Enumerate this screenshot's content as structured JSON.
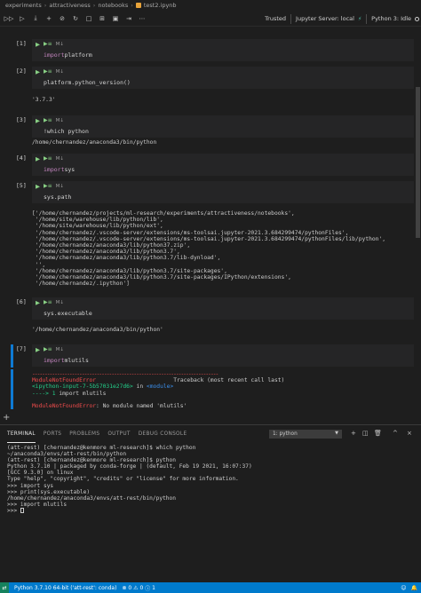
{
  "breadcrumb": {
    "items": [
      "experiments",
      "attractiveness",
      "notebooks",
      "test2.ipynb"
    ]
  },
  "toolbar": {
    "buttons": [
      {
        "icon": "run-all-icon",
        "glyph": "▷▷"
      },
      {
        "icon": "run-icon",
        "glyph": "▷"
      },
      {
        "icon": "run-below-icon",
        "glyph": "⤓"
      },
      {
        "icon": "add-icon",
        "glyph": "+"
      },
      {
        "icon": "clear-icon",
        "glyph": "⊘"
      },
      {
        "icon": "restart-icon",
        "glyph": "↻"
      },
      {
        "icon": "stop-icon",
        "glyph": "□"
      },
      {
        "icon": "variables-icon",
        "glyph": "⊞"
      },
      {
        "icon": "save-icon",
        "glyph": "▣"
      },
      {
        "icon": "export-icon",
        "glyph": "⇥"
      },
      {
        "icon": "more-icon",
        "glyph": "⋯"
      }
    ],
    "trusted": "Trusted",
    "jupyter_server": "Jupyter Server: local",
    "kernel": "Python 3: Idle"
  },
  "cells": [
    {
      "count": "[1]",
      "code_kw": "import",
      "code_rest": " platform",
      "output": ""
    },
    {
      "count": "[2]",
      "code_kw": "",
      "code_rest": "platform.python_version()",
      "output": "'3.7.3'"
    },
    {
      "count": "[3]",
      "code_kw": "",
      "code_rest": "!which python",
      "output": "/home/chernandez/anaconda3/bin/python"
    },
    {
      "count": "[4]",
      "code_kw": "import",
      "code_rest": " sys",
      "output": ""
    },
    {
      "count": "[5]",
      "code_kw": "",
      "code_rest": "sys.path",
      "output": "['/home/chernandez/projects/ml-research/experiments/attractiveness/notebooks',\n '/home/site/warehouse/lib/python/lib',\n '/home/site/warehouse/lib/python/ext',\n '/home/chernandez/.vscode-server/extensions/ms-toolsai.jupyter-2021.3.684299474/pythonFiles',\n '/home/chernandez/.vscode-server/extensions/ms-toolsai.jupyter-2021.3.684299474/pythonFiles/lib/python',\n '/home/chernandez/anaconda3/lib/python37.zip',\n '/home/chernandez/anaconda3/lib/python3.7',\n '/home/chernandez/anaconda3/lib/python3.7/lib-dynload',\n '',\n '/home/chernandez/anaconda3/lib/python3.7/site-packages',\n '/home/chernandez/anaconda3/lib/python3.7/site-packages/IPython/extensions',\n '/home/chernandez/.ipython']"
    },
    {
      "count": "[6]",
      "code_kw": "",
      "code_rest": "sys.executable",
      "output": "'/home/chernandez/anaconda3/bin/python'"
    },
    {
      "count": "[7]",
      "code_kw": "import",
      "code_rest": " mlutils",
      "output": ""
    }
  ],
  "error": {
    "dashes": "---------------------------------------------------------------------------",
    "name": "ModuleNotFoundError",
    "traceback_label": "Traceback (most recent call last)",
    "input_ref": "<ipython-input-7-5b57031e27d6>",
    "in_text": " in ",
    "module_ref": "<module>",
    "arrow": "----> 1 ",
    "arrow_code": "import mlutils",
    "message": ": No module named 'mlutils'"
  },
  "panel": {
    "tabs": [
      "TERMINAL",
      "PORTS",
      "PROBLEMS",
      "OUTPUT",
      "DEBUG CONSOLE"
    ],
    "terminal_select": "1: python",
    "terminal_lines": "(att-rest) [chernandez@kenmore ml-research]$ which python\n~/anaconda3/envs/att-rest/bin/python\n(att-rest) [chernandez@kenmore ml-research]$ python\nPython 3.7.10 | packaged by conda-forge | (default, Feb 19 2021, 16:07:37)\n[GCC 9.3.0] on linux\nType \"help\", \"copyright\", \"credits\" or \"license\" for more information.\n>>> import sys\n>>> print(sys.executable)\n/home/chernandez/anaconda3/envs/att-rest/bin/python\n>>> import mlutils\n>>> "
  },
  "statusbar": {
    "interpreter": "Python 3.7.10 64-bit ('att-rest': conda)",
    "errors": "0",
    "warnings": "0",
    "info": "1"
  },
  "colors": {
    "statusbar": "#007acc",
    "accent_blue": "#0e7ad3",
    "error_red": "#f14c4c",
    "run_green": "#89d185"
  }
}
